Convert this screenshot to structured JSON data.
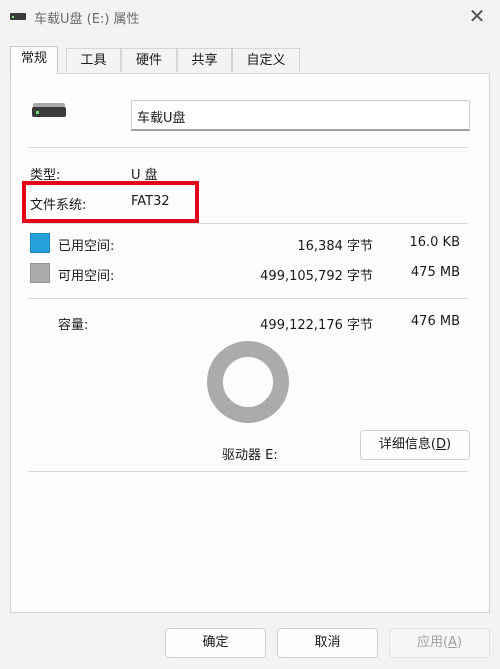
{
  "window": {
    "title": "车载U盘 (E:) 属性",
    "close_glyph": "✕"
  },
  "tabs": [
    {
      "label": "常规",
      "active": true
    },
    {
      "label": "工具",
      "active": false
    },
    {
      "label": "硬件",
      "active": false
    },
    {
      "label": "共享",
      "active": false
    },
    {
      "label": "自定义",
      "active": false
    }
  ],
  "general": {
    "volume_label": "车载U盘",
    "type_label": "类型:",
    "type_value": "U 盘",
    "filesystem_label": "文件系统:",
    "filesystem_value": "FAT32",
    "used": {
      "label": "已用空间:",
      "bytes": "16,384 字节",
      "size": "16.0 KB"
    },
    "free": {
      "label": "可用空间:",
      "bytes": "499,105,792 字节",
      "size": "475 MB"
    },
    "capacity": {
      "label": "容量:",
      "bytes": "499,122,176 字节",
      "size": "476 MB"
    },
    "drive_label": "驱动器 E:",
    "details_button": {
      "text": "详细信息(",
      "mnemonic": "D",
      "suffix": ")"
    },
    "usage_fraction_used": 3.28e-05
  },
  "buttons": {
    "ok": "确定",
    "cancel": "取消",
    "apply": {
      "text": "应用(",
      "mnemonic": "A",
      "suffix": ")"
    }
  },
  "colors": {
    "used": "#26a0da",
    "free": "#ababab",
    "highlight": "#e3001b"
  },
  "icons": {
    "title": "drive-icon",
    "drive": "usb-drive-icon"
  }
}
